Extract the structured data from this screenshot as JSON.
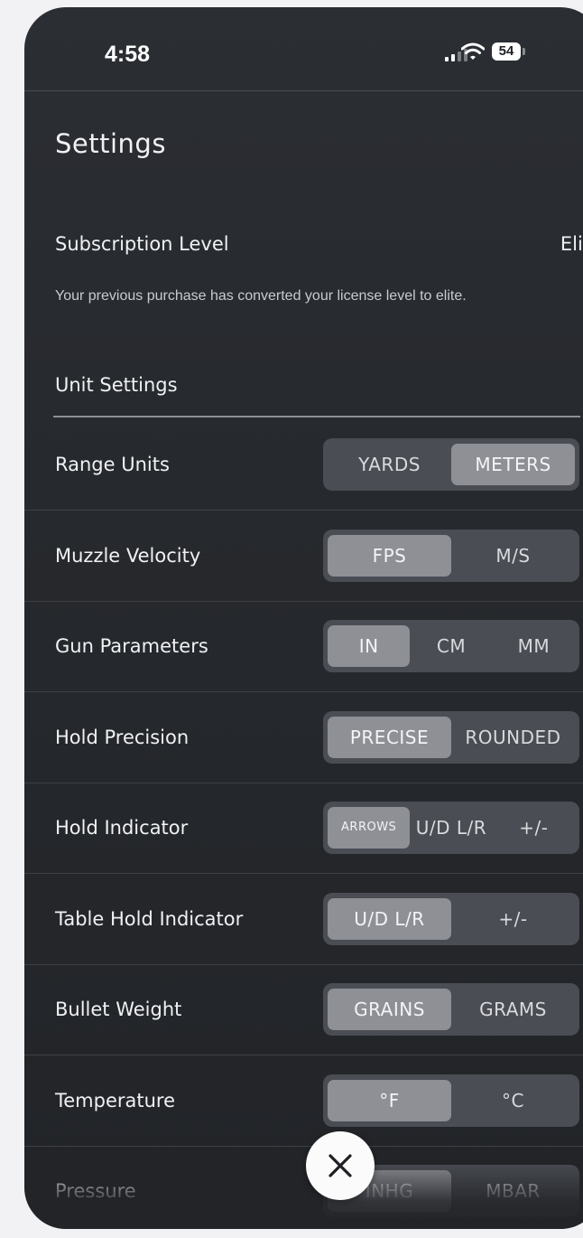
{
  "status_bar": {
    "time": "4:58",
    "battery": "54"
  },
  "page": {
    "title": "Settings"
  },
  "subscription": {
    "label": "Subscription Level",
    "value": "Elite",
    "note": "Your previous purchase has converted your license level to elite."
  },
  "unit_settings": {
    "heading": "Unit Settings",
    "rows": [
      {
        "label": "Range Units",
        "options": [
          "YARDS",
          "METERS"
        ],
        "selected": "METERS"
      },
      {
        "label": "Muzzle Velocity",
        "options": [
          "FPS",
          "M/S"
        ],
        "selected": "FPS"
      },
      {
        "label": "Gun Parameters",
        "options": [
          "IN",
          "CM",
          "MM"
        ],
        "selected": "IN"
      },
      {
        "label": "Hold Precision",
        "options": [
          "PRECISE",
          "ROUNDED"
        ],
        "selected": "PRECISE"
      },
      {
        "label": "Hold Indicator",
        "options": [
          "ARROWS",
          "U/D L/R",
          "+/-"
        ],
        "selected": "ARROWS"
      },
      {
        "label": "Table Hold Indicator",
        "options": [
          "U/D L/R",
          "+/-"
        ],
        "selected": "U/D L/R"
      },
      {
        "label": "Bullet Weight",
        "options": [
          "GRAINS",
          "GRAMS"
        ],
        "selected": "GRAINS"
      },
      {
        "label": "Temperature",
        "options": [
          "°F",
          "°C"
        ],
        "selected": "°F"
      },
      {
        "label": "Pressure",
        "options": [
          "INHG",
          "MBAR"
        ],
        "selected": "INHG"
      }
    ]
  },
  "icons": {
    "close": "close-icon",
    "wifi": "wifi-icon",
    "signal": "cellular-signal-icon",
    "battery": "battery-icon"
  }
}
